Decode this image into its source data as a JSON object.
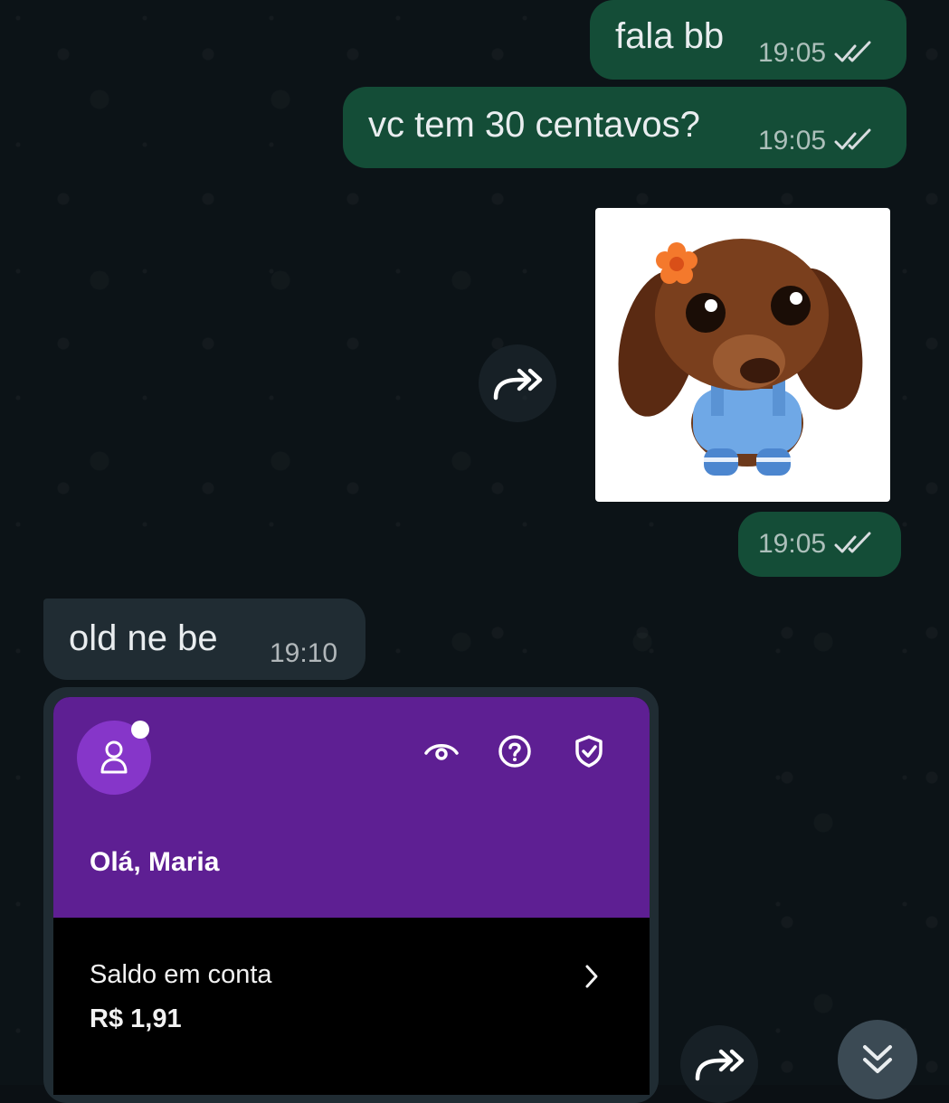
{
  "messages": [
    {
      "text": "fala bb",
      "time": "19:05"
    },
    {
      "text": "vc tem 30 centavos?",
      "time": "19:05"
    },
    {
      "time": "19:05"
    },
    {
      "text": "old ne be",
      "time": "19:10"
    }
  ],
  "forward_icon": "forward-icon",
  "read_status_icon": "double-check-icon",
  "bank_screenshot": {
    "greeting": "Olá, Maria",
    "balance_label": "Saldo em conta",
    "balance_value": "R$ 1,91",
    "header_icons": [
      "eye-icon",
      "help-icon",
      "shield-check-icon"
    ]
  },
  "scroll_button_icon": "double-chevron-down-icon",
  "colors": {
    "background": "#0c1317",
    "outgoing_bubble": "#144d37",
    "incoming_bubble": "#202c33",
    "bank_purple": "#5e1f93",
    "read_ticks": "#e9edef"
  }
}
